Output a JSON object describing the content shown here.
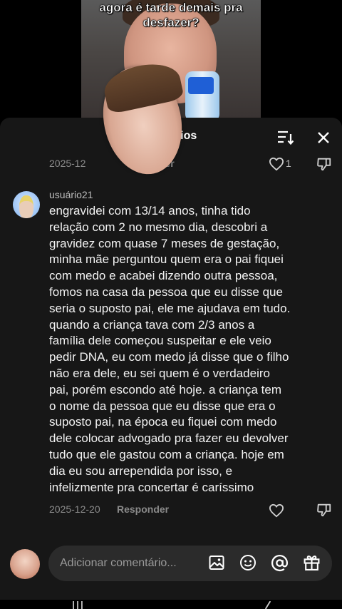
{
  "video": {
    "caption": "agora é tarde demais pra\ndesfazer?"
  },
  "sheet": {
    "title": "entários"
  },
  "prev_comment": {
    "date": "2025-12",
    "reply_label": "ider",
    "like_count": "1"
  },
  "comment": {
    "username": "usuário21",
    "text": "engravidei com 13/14 anos, tinha tido\nrelação com 2 no mesmo dia, descobri a\ngravidez com quase 7 meses de gestação,\nminha mãe perguntou quem era o pai fiquei\ncom medo e acabei dizendo outra pessoa,\nfomos na casa da pessoa que eu disse que\nseria o suposto pai, ele me ajudava em tudo.\nquando a criança tava com 2/3 anos a\nfamília dele começou suspeitar e ele veio\npedir DNA, eu com medo já disse que o filho\nnão era dele, eu sei quem é o verdadeiro\npai, porém escondo até hoje. a criança tem\no nome da pessoa que eu disse que era o\nsuposto pai, na época eu fiquei com medo\ndele colocar advogado pra fazer eu devolver\ntudo que ele gastou com a criança. hoje em\ndia eu sou arrependida por isso, e\ninfelizmente pra concertar é caríssimo",
    "date": "2025-12-20",
    "reply_label": "Responder"
  },
  "input": {
    "placeholder": "Adicionar comentário..."
  },
  "icons": {
    "sort": "sort-icon",
    "close": "close-icon",
    "heart": "heart-icon",
    "dislike": "dislike-icon",
    "image": "image-icon",
    "emoji": "emoji-icon",
    "mention": "at-mention-icon",
    "gift": "gift-icon"
  }
}
